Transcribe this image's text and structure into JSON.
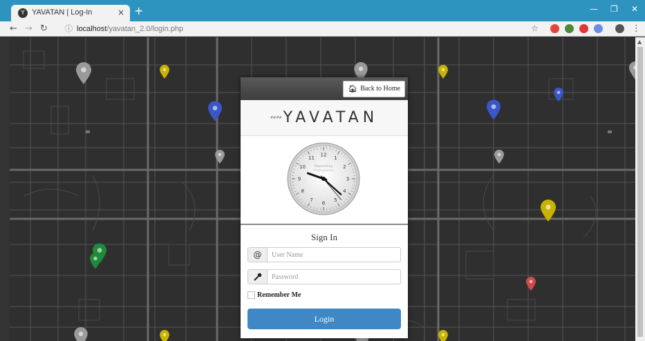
{
  "browser": {
    "tab_title": "YAVATAN | Log-In",
    "tab_close": "×",
    "new_tab": "+",
    "favicon": "Y",
    "url_host": "localhost",
    "url_path": "/yavatan_2.0/login.php",
    "minimize": "—",
    "restore": "❐",
    "close": "✕"
  },
  "panel": {
    "back_home_label": "Back to Home",
    "brand_name": "YAVATAN",
    "clock": {
      "powered_by": "Powered by",
      "brand_mark": "Analogclocks",
      "numbers": [
        "12",
        "1",
        "2",
        "3",
        "4",
        "5",
        "6",
        "7",
        "8",
        "9",
        "10",
        "11"
      ],
      "time": {
        "hour": 9.65,
        "minute": 22,
        "second": 0
      }
    },
    "signin_title": "Sign In",
    "username": {
      "placeholder": "User Name",
      "addon": "@"
    },
    "password": {
      "placeholder": "Password"
    },
    "remember_label": "Remember Me",
    "login_label": "Login"
  },
  "pins": [
    {
      "color": "#9a9a9a"
    },
    {
      "color": "#c9b200"
    },
    {
      "color": "#3a56c8"
    },
    {
      "color": "#9a9a9a"
    },
    {
      "color": "#9a9a9a"
    },
    {
      "color": "#c9b200"
    },
    {
      "color": "#3a56c8"
    },
    {
      "color": "#3a56c8"
    },
    {
      "color": "#9a9a9a"
    },
    {
      "color": "#c9b200"
    },
    {
      "color": "#d04a4a"
    },
    {
      "color": "#1f8a3a"
    },
    {
      "color": "#1f8a3a"
    },
    {
      "color": "#9a9a9a"
    },
    {
      "color": "#c9b200"
    },
    {
      "color": "#9a9a9a"
    },
    {
      "color": "#c9b200"
    },
    {
      "color": "#9a9a9a"
    }
  ]
}
